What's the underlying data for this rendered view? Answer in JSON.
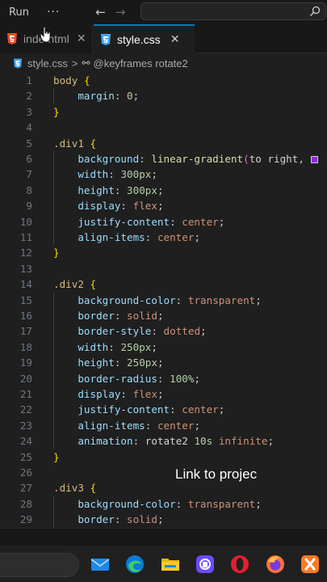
{
  "titlebar": {
    "run_label": "Run",
    "more_label": "···",
    "back_label": "←",
    "forward_label": "→"
  },
  "tabs": [
    {
      "label": "index.html",
      "visible_label": "inde  html",
      "close": "✕",
      "icon": "html5-icon",
      "active": false
    },
    {
      "label": "style.css",
      "close": "✕",
      "icon": "css3-icon",
      "active": true
    }
  ],
  "breadcrumb": {
    "file": "style.css",
    "separator": ">",
    "symbol_icon": "⚯",
    "symbol": "@keyframes rotate2"
  },
  "editor": {
    "lines": [
      {
        "n": "1"
      },
      {
        "n": "2"
      },
      {
        "n": "3"
      },
      {
        "n": "4"
      },
      {
        "n": "5"
      },
      {
        "n": "6"
      },
      {
        "n": "7"
      },
      {
        "n": "8"
      },
      {
        "n": "9"
      },
      {
        "n": "10"
      },
      {
        "n": "11"
      },
      {
        "n": "12"
      },
      {
        "n": "13"
      },
      {
        "n": "14"
      },
      {
        "n": "15"
      },
      {
        "n": "16"
      },
      {
        "n": "17"
      },
      {
        "n": "18"
      },
      {
        "n": "19"
      },
      {
        "n": "20"
      },
      {
        "n": "21"
      },
      {
        "n": "22"
      },
      {
        "n": "23"
      },
      {
        "n": "24"
      },
      {
        "n": "25"
      },
      {
        "n": "26"
      },
      {
        "n": "27"
      },
      {
        "n": "28"
      },
      {
        "n": "29"
      }
    ],
    "tokens": {
      "body": "body",
      "ob": "{",
      "cb": "}",
      "margin": "margin",
      "zero": "0",
      "colon": ":",
      "semi": ";",
      "div1": ".div1",
      "div2": ".div2",
      "div3": ".div3",
      "background": "background",
      "lg": "linear-gradient",
      "lp": "(",
      "to_right": "to right",
      "comma": ",",
      "width": "width",
      "height": "height",
      "display": "display",
      "flex": "flex",
      "jc": "justify-content",
      "ai": "align-items",
      "center": "center",
      "bgc": "background-color",
      "transparent": "transparent",
      "border": "border",
      "solid": "solid",
      "bstyle": "border-style",
      "dotted": "dotted",
      "bradius": "border-radius",
      "animation": "animation",
      "rotate2": "rotate2",
      "infinite": "infinite",
      "n300": "300",
      "n250": "250",
      "n100": "100",
      "n10": "10",
      "px": "px",
      "pct": "%",
      "s": "s"
    }
  },
  "overlay_text": "Link to projec",
  "taskbar": {
    "apps": [
      "mail-icon",
      "edge-icon",
      "file-explorer-icon",
      "proton-icon",
      "opera-icon",
      "firefox-icon",
      "xampp-icon"
    ]
  }
}
